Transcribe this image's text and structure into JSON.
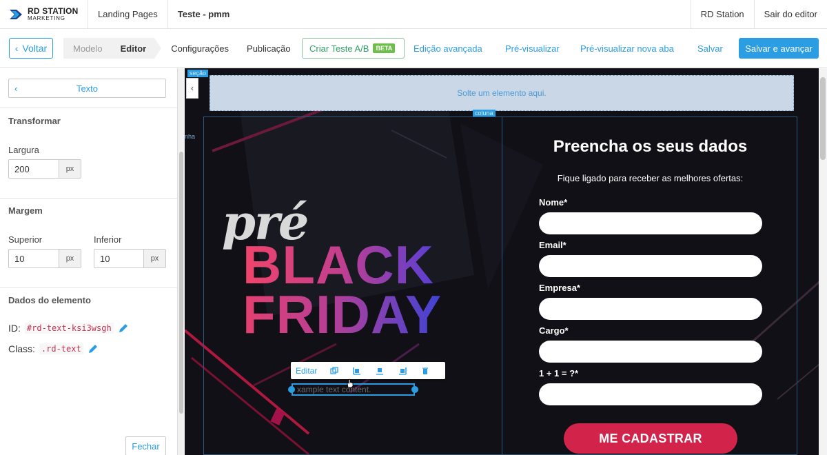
{
  "topbar": {
    "logo_line1": "RD STATION",
    "logo_line2": "MARKETING",
    "landing_pages": "Landing Pages",
    "page_title": "Teste - pmm",
    "rd_station": "RD Station",
    "exit_editor": "Sair do editor"
  },
  "toolbar": {
    "back": "Voltar",
    "steps": [
      "Modelo",
      "Editor",
      "Configurações",
      "Publicação"
    ],
    "ab_test": "Criar Teste A/B",
    "beta": "BETA",
    "advanced_edit": "Edição avançada",
    "preview": "Pré-visualizar",
    "preview_new_tab": "Pré-visualizar nova aba",
    "save": "Salvar",
    "save_continue": "Salvar e avançar"
  },
  "panel": {
    "element_type": "Texto",
    "transform_title": "Transformar",
    "width_label": "Largura",
    "width_value": "200",
    "unit": "px",
    "margin_title": "Margem",
    "top_label": "Superior",
    "top_value": "10",
    "bottom_label": "Inferior",
    "bottom_value": "10",
    "element_data_title": "Dados do elemento",
    "id_label": "ID:",
    "id_value": "#rd-text-ksi3wsgh",
    "class_label": "Class:",
    "class_value": ".rd-text",
    "close": "Fechar"
  },
  "canvas": {
    "section_tag": "seção",
    "column_tag": "coluna",
    "row_tag": "nha",
    "drop_zone": "Solte um elemento aqui.",
    "hero_pre": "pré",
    "hero_black": "BLACK",
    "hero_friday": "FRIDAY",
    "edit": "Editar",
    "text_placeholder": "xample text content.",
    "form_title": "Preencha os seus dados",
    "form_subtitle": "Fique ligado para receber as melhores ofertas:",
    "fields": [
      "Nome*",
      "Email*",
      "Empresa*",
      "Cargo*",
      "1 + 1 = ?*"
    ],
    "cta": "ME CADASTRAR"
  },
  "colors": {
    "accent": "#2b9de2",
    "cta": "#d2234a",
    "background": "#0f0e14"
  }
}
